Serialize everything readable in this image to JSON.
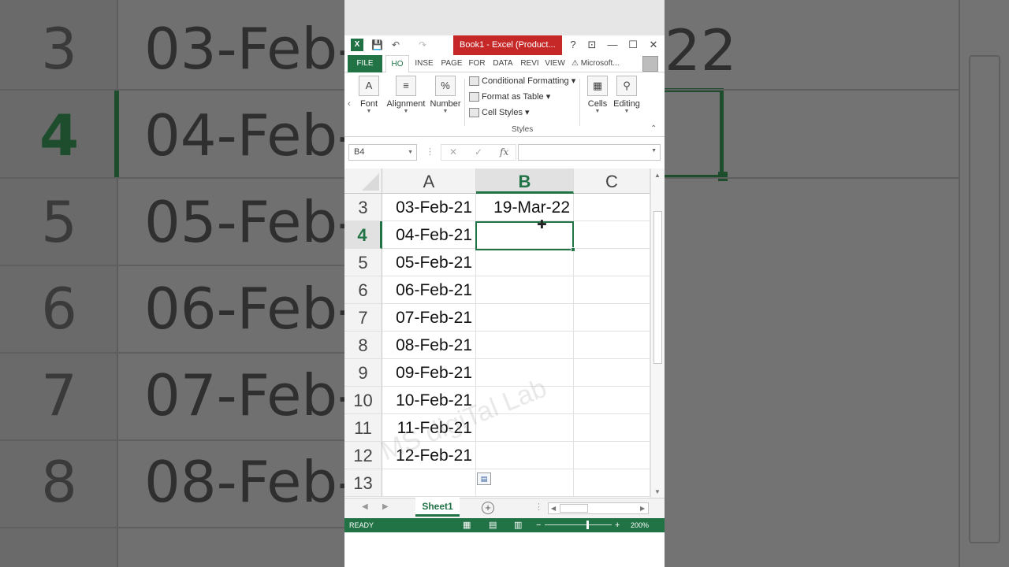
{
  "window": {
    "title": "Book1 - Excel (Product...",
    "controls": {
      "help": "?",
      "restore_ribbon": "⊡",
      "minimize": "—",
      "maximize": "☐",
      "close": "✕"
    }
  },
  "quick_access": {
    "save": "💾",
    "undo": "↶",
    "redo": "↷"
  },
  "tabs": [
    "FILE",
    "HO",
    "INSE",
    "PAGE",
    "FOR",
    "DATA",
    "REVI",
    "VIEW"
  ],
  "account": "⚠ Microsoft...",
  "ribbon": {
    "font": "Font",
    "alignment": "Alignment",
    "number": "Number",
    "conditional_formatting": "Conditional Formatting",
    "format_as_table": "Format as Table",
    "cell_styles": "Cell Styles",
    "styles_group": "Styles",
    "cells": "Cells",
    "editing": "Editing"
  },
  "formula_bar": {
    "name_box": "B4",
    "cancel": "✕",
    "enter": "✓",
    "fx": "fx",
    "value": ""
  },
  "columns": [
    "A",
    "B",
    "C"
  ],
  "selected_column": "B",
  "rows": [
    {
      "num": "3",
      "a": "03-Feb-21",
      "b": "19-Mar-22"
    },
    {
      "num": "4",
      "a": "04-Feb-21",
      "b": ""
    },
    {
      "num": "5",
      "a": "05-Feb-21",
      "b": ""
    },
    {
      "num": "6",
      "a": "06-Feb-21",
      "b": ""
    },
    {
      "num": "7",
      "a": "07-Feb-21",
      "b": ""
    },
    {
      "num": "8",
      "a": "08-Feb-21",
      "b": ""
    },
    {
      "num": "9",
      "a": "09-Feb-21",
      "b": ""
    },
    {
      "num": "10",
      "a": "10-Feb-21",
      "b": ""
    },
    {
      "num": "11",
      "a": "11-Feb-21",
      "b": ""
    },
    {
      "num": "12",
      "a": "12-Feb-21",
      "b": ""
    },
    {
      "num": "13",
      "a": "",
      "b": ""
    }
  ],
  "active_cell": "B4",
  "watermark": "MS digiTal Lab",
  "sheet_tab": "Sheet1",
  "add_sheet": "+",
  "status": {
    "ready": "READY",
    "zoom": "200%",
    "zoom_minus": "−",
    "zoom_plus": "+"
  },
  "background": {
    "rows": [
      "3",
      "4",
      "5",
      "6",
      "7",
      "8"
    ],
    "dates": [
      "03-Feb-",
      "04-Feb-",
      "05-Feb-",
      "06-Feb-",
      "07-Feb-",
      "08-Feb-"
    ],
    "right_text": "22"
  }
}
